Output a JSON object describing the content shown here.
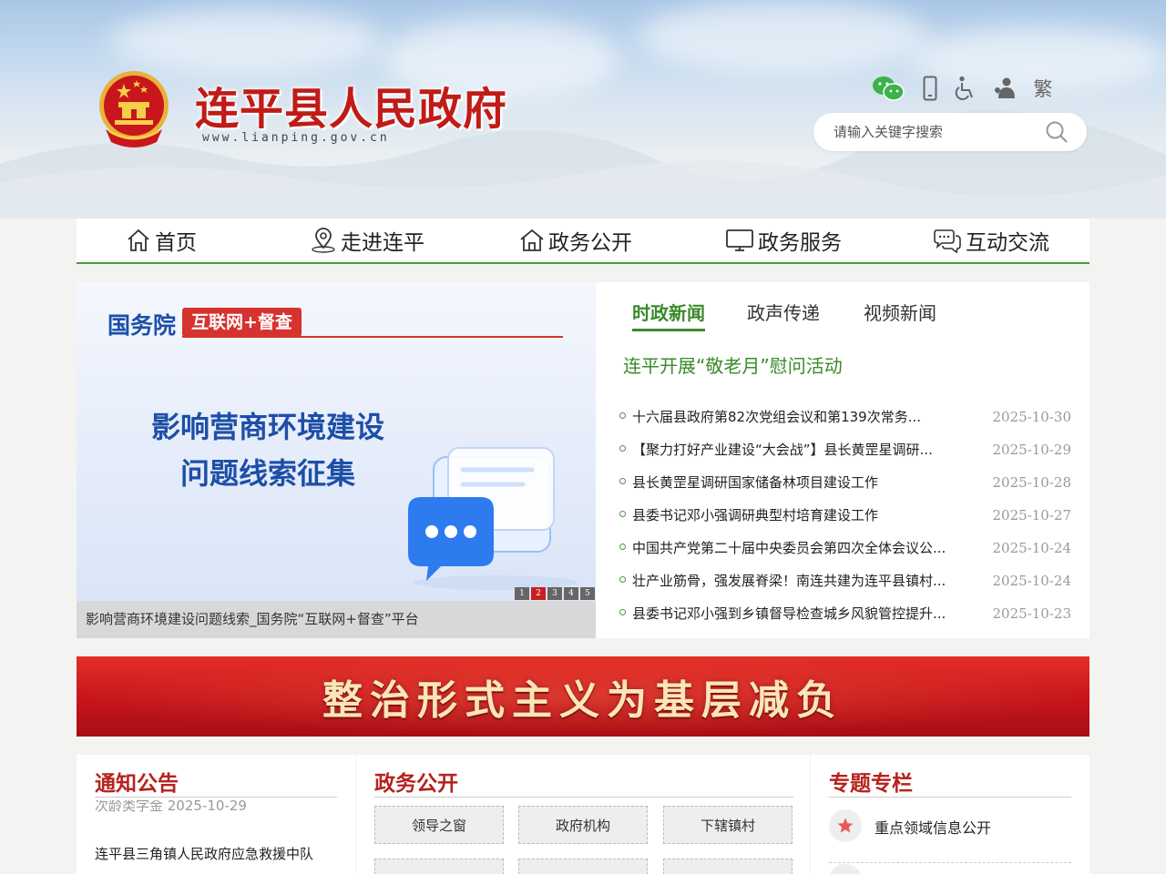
{
  "header": {
    "site_title": "连平县人民政府",
    "site_url": "www.lianping.gov.cn",
    "tools": {
      "wechat_icon": "wechat-icon",
      "mobile_icon": "mobile-icon",
      "accessibility_icon": "wheelchair-icon",
      "elderly_icon": "care-icon",
      "traditional_label": "繁"
    },
    "search": {
      "placeholder": "请输入关键字搜索",
      "value": ""
    }
  },
  "nav": {
    "items": [
      {
        "label": "首页",
        "icon": "home-icon"
      },
      {
        "label": "走进连平",
        "icon": "location-pin-icon"
      },
      {
        "label": "政务公开",
        "icon": "house-icon"
      },
      {
        "label": "政务服务",
        "icon": "monitor-icon"
      },
      {
        "label": "互动交流",
        "icon": "chat-bubbles-icon"
      }
    ]
  },
  "slider": {
    "brand_name": "国务院",
    "brand_tag": "互联网+督查",
    "headline_line1": "影响营商环境建设",
    "headline_line2": "问题线索征集",
    "caption": "影响营商环境建设问题线索_国务院“互联网+督查”平台",
    "dots": [
      "1",
      "2",
      "3",
      "4",
      "5"
    ],
    "active_dot": 2
  },
  "news": {
    "tabs": [
      "时政新闻",
      "政声传递",
      "视频新闻"
    ],
    "active_tab": 0,
    "headline": "连平开展“敬老月”慰问活动",
    "items": [
      {
        "title": "十六届县政府第82次党组会议和第139次常务...",
        "date": "2025-10-30"
      },
      {
        "title": "【聚力打好产业建设“大会战”】县长黄罡星调研...",
        "date": "2025-10-29"
      },
      {
        "title": "县长黄罡星调研国家储备林项目建设工作",
        "date": "2025-10-28"
      },
      {
        "title": "县委书记邓小强调研典型村培育建设工作",
        "date": "2025-10-27"
      },
      {
        "title": "中国共产党第二十届中央委员会第四次全体会议公...",
        "date": "2025-10-24"
      },
      {
        "title": "壮产业筋骨，强发展脊梁！南连共建为连平县镇村...",
        "date": "2025-10-24"
      },
      {
        "title": "县委书记邓小强到乡镇督导检查城乡风貌管控提升...",
        "date": "2025-10-23"
      }
    ]
  },
  "banner": {
    "text": "整治形式主义为基层减负"
  },
  "notice": {
    "title": "通知公告",
    "partial_line": "次龄类字金 2025-10-29",
    "item_line": "连平县三角镇人民政府应急救援中队"
  },
  "gov_open": {
    "title": "政务公开",
    "buttons": [
      "领导之窗",
      "政府机构",
      "下辖镇村"
    ]
  },
  "topics": {
    "title": "专题专栏",
    "items": [
      {
        "label": "重点领域信息公开",
        "icon": "star-icon",
        "color": "#e85a5a"
      }
    ]
  },
  "colors": {
    "brand_red": "#c11b17",
    "accent_green": "#3a8a2a",
    "section_red": "#b7221c"
  }
}
